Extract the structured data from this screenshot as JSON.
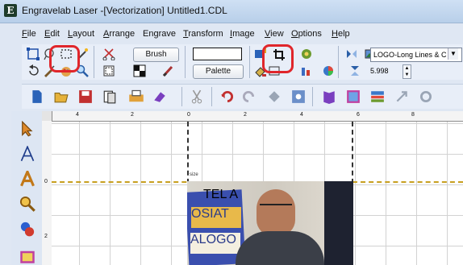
{
  "window": {
    "title": "Engravelab Laser -[Vectorization] Untitled1.CDL",
    "app_icon_letter": "E"
  },
  "menu": [
    {
      "label": "File",
      "u": "F",
      "rest": "ile"
    },
    {
      "label": "Edit",
      "u": "E",
      "rest": "dit"
    },
    {
      "label": "Layout",
      "u": "L",
      "rest": "ayout"
    },
    {
      "label": "Arrange",
      "u": "A",
      "rest": "rrange"
    },
    {
      "label": "Engrave",
      "u": "",
      "rest": "Engrave"
    },
    {
      "label": "Transform",
      "u": "T",
      "rest": "ransform"
    },
    {
      "label": "Image",
      "u": "I",
      "rest": "mage"
    },
    {
      "label": "View",
      "u": "V",
      "rest": "iew"
    },
    {
      "label": "Options",
      "u": "O",
      "rest": "ptions"
    },
    {
      "label": "Help",
      "u": "H",
      "rest": "elp"
    }
  ],
  "toolbar": {
    "brush_label": "Brush",
    "palette_label": "Palette",
    "font_select_value": "LOGO-Long Lines & C",
    "size_value": "5.998"
  },
  "rulers": {
    "top_ticks": [
      "4",
      "2",
      "0",
      "2",
      "4",
      "6",
      "8"
    ],
    "left_ticks": [
      "0",
      "2"
    ]
  },
  "canvas": {
    "photo_texts": [
      "TEL A",
      "OSIAT",
      "ALOGO"
    ],
    "small_label": "size"
  },
  "colors": {
    "highlight": "#e0262b",
    "photo_frame": "#3a4fae"
  }
}
